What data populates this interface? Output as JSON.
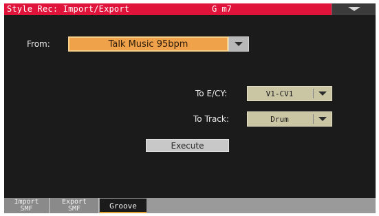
{
  "window": {
    "title": "Style Rec: Import/Export",
    "chord": "G m7",
    "menu_icon": "chevron-down-icon"
  },
  "colors": {
    "title_bar": "#e0143a",
    "screen_bg": "#1b1b1b",
    "selected_field": "#f0a24b",
    "combo_bg": "#cac6a4"
  },
  "from": {
    "label": "From:",
    "value": "Talk Music 95bpm"
  },
  "to_ecy": {
    "label": "To E/CY:",
    "value": "V1-CV1"
  },
  "to_track": {
    "label": "To Track:",
    "value": "Drum"
  },
  "execute": {
    "label": "Execute"
  },
  "tabs": [
    {
      "line1": "Import",
      "line2": "SMF",
      "active": false
    },
    {
      "line1": "Export",
      "line2": "SMF",
      "active": false
    },
    {
      "line1": "Groove",
      "line2": "",
      "active": true
    }
  ]
}
